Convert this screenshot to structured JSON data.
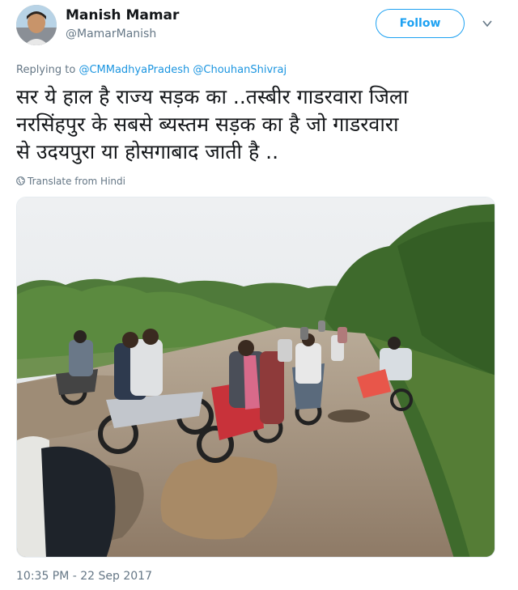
{
  "author": {
    "name": "Manish Mamar",
    "handle": "@MamarManish",
    "avatar_icon": "user-avatar"
  },
  "follow_label": "Follow",
  "reply": {
    "prefix": "Replying to",
    "mentions": [
      "@CMMadhyaPradesh",
      "@ChouhanShivraj"
    ]
  },
  "tweet_text": "सर ये हाल है राज्य सड़क का ..तस्बीर गाडरवारा जिला\nनरसिंहपुर के सबसे ब्यस्तम सड़क का है जो गाडरवारा\nसे उदयपुरा या होसगाबाद जाती है ..",
  "translate_label": "Translate from Hindi",
  "timestamp": "10:35 PM - 22 Sep 2017",
  "colors": {
    "accent": "#1da1f2",
    "mention": "#1b95e0",
    "secondary_text": "#657786",
    "primary_text": "#14171a"
  }
}
